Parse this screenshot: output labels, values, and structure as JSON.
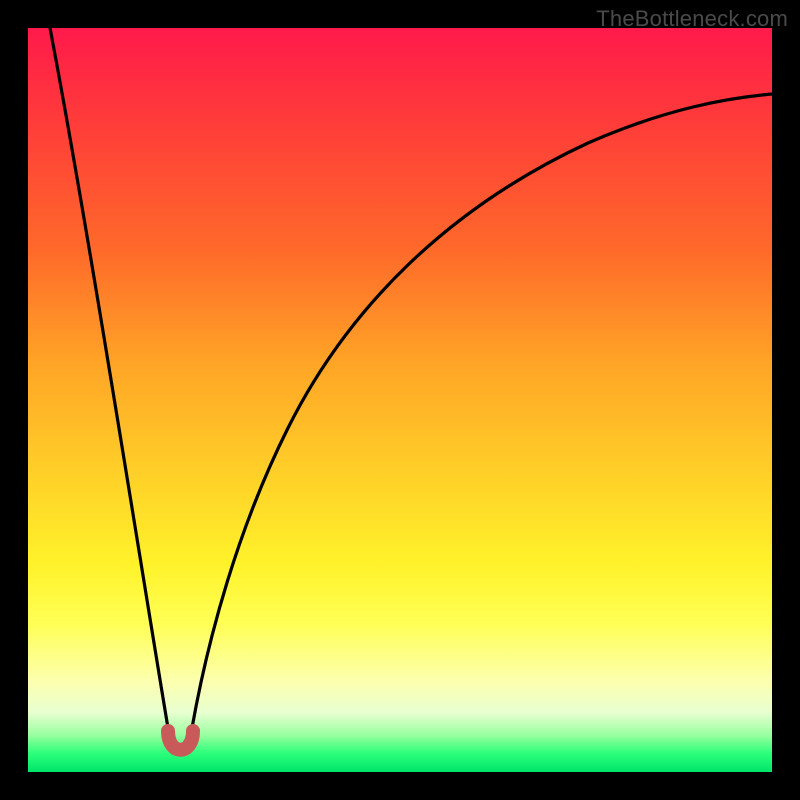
{
  "watermark": "TheBottleneck.com",
  "chart_data": {
    "type": "line",
    "title": "",
    "xlabel": "",
    "ylabel": "",
    "xlim": [
      0,
      100
    ],
    "ylim": [
      0,
      100
    ],
    "series": [
      {
        "name": "bottleneck-curve",
        "x": [
          3,
          6,
          9,
          12,
          15,
          17,
          18.5,
          19.3,
          20,
          20.8,
          22,
          24,
          27,
          31,
          36,
          42,
          50,
          60,
          72,
          86,
          100
        ],
        "y": [
          100,
          84,
          68,
          52,
          36,
          22,
          12,
          6,
          3,
          6,
          14,
          27,
          40,
          52,
          62,
          70,
          77,
          82,
          86,
          88.5,
          90
        ]
      }
    ],
    "annotations": [
      {
        "name": "optimal-marker",
        "x": 20,
        "y": 3
      }
    ],
    "gradient_stops": [
      {
        "pos": 0,
        "color": "#ff1a4b"
      },
      {
        "pos": 0.45,
        "color": "#ffa426"
      },
      {
        "pos": 0.72,
        "color": "#fff22a"
      },
      {
        "pos": 0.95,
        "color": "#9affa0"
      },
      {
        "pos": 1.0,
        "color": "#00e56a"
      }
    ]
  }
}
